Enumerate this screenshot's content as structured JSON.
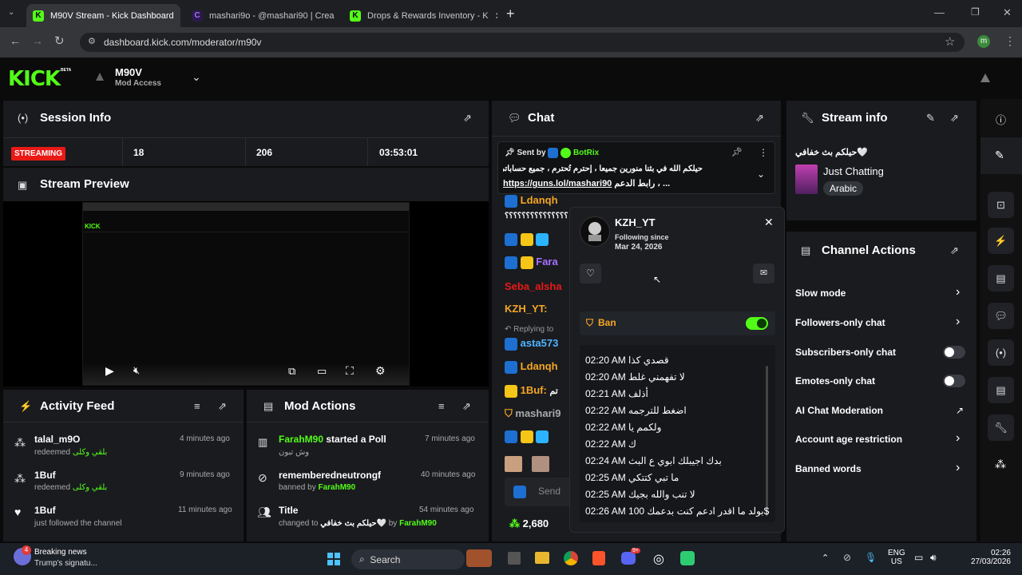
{
  "browser": {
    "tabs": [
      {
        "title": "M90V Stream - Kick Dashboard",
        "favicon": "K",
        "active": true
      },
      {
        "title": "mashari9o - @mashari90 | Crea",
        "favicon": "C",
        "active": false
      },
      {
        "title": "Drops & Rewards Inventory - K",
        "favicon": "K",
        "active": false
      }
    ],
    "url": "dashboard.kick.com/moderator/m90v",
    "profile_initial": "m"
  },
  "header": {
    "logo": "KICK",
    "beta": "BETA",
    "channel_name": "M90V",
    "channel_role": "Mod Access"
  },
  "session": {
    "title": "Session Info",
    "status": "STREAMING",
    "stat1": "18",
    "stat2": "206",
    "duration": "03:53:01"
  },
  "preview": {
    "title": "Stream Preview"
  },
  "activity": {
    "title": "Activity Feed",
    "items": [
      {
        "user": "talal_m9O",
        "action": "redeemed",
        "reward": "بلقي وكلى",
        "time": "4 minutes ago"
      },
      {
        "user": "1Buf",
        "action": "redeemed",
        "reward": "بلقي وكلى",
        "time": "9 minutes ago"
      },
      {
        "user": "1Buf",
        "action": "just followed the channel",
        "time": "11 minutes ago"
      }
    ]
  },
  "mod_actions": {
    "title": "Mod Actions",
    "items": [
      {
        "user": "FarahM90",
        "action": " started a Poll",
        "sub": "وش تبون",
        "time": "7 minutes ago"
      },
      {
        "user": "rememberedneutrongf",
        "action": "",
        "sub_prefix": "banned by ",
        "sub_user": "FarahM90",
        "time": "40 minutes ago"
      },
      {
        "user": "Title",
        "action": "",
        "sub_prefix": "changed to ",
        "sub_value": "حيلكم بث خفافي🤍",
        "sub_by": " by ",
        "sub_user": "FarahM90",
        "time": "54 minutes ago"
      }
    ]
  },
  "chat": {
    "title": "Chat",
    "pinned": {
      "label": "Sent by",
      "user": "BotRix",
      "text": "حيلكم الله في بثنا منورين جميعا ، إحترم تُحترم ، جميع حساباتي",
      "link": "https://guns.lol/mashari90",
      "link_suffix": "رابط الدعم ، ..."
    },
    "lines": [
      {
        "user": "Ldanqh",
        "color": "#f5a623",
        "text": "؟؟؟؟؟؟؟؟؟؟؟؟؟؟؟"
      },
      {
        "user": "",
        "color": "#53fc18",
        "text": ""
      },
      {
        "user": "Fara",
        "color": "#a970ff",
        "text": ""
      },
      {
        "user": "Seba_alsha",
        "color": "#e91916",
        "text": ""
      },
      {
        "user": "KZH_YT:",
        "color": "#f5a623",
        "text": ""
      },
      {
        "user": "asta573",
        "color": "#4fb3ff",
        "text": ""
      },
      {
        "user": "Ldanqh",
        "color": "#f5a623",
        "text": ""
      },
      {
        "user": "1Buf:",
        "color": "#f5a623",
        "text": "تم"
      },
      {
        "user": "mashari9",
        "color": "#aaaaaa",
        "text": ""
      }
    ],
    "replying": "Replying to",
    "send_placeholder": "Send",
    "points": "2,680"
  },
  "user_card": {
    "username": "KZH_YT",
    "following_label": "Following since",
    "following_date": "Mar 24, 2026",
    "ban_label": "Ban",
    "messages": [
      {
        "time": "02:20 AM",
        "text": "قصدي كذا"
      },
      {
        "time": "02:20 AM",
        "text": "لا تفهمني غلط"
      },
      {
        "time": "02:21 AM",
        "text": "أذلف"
      },
      {
        "time": "02:22 AM",
        "text": "اضغط للترجمه"
      },
      {
        "time": "02:22 AM",
        "text": "ولكمم يا"
      },
      {
        "time": "02:22 AM",
        "text": "ك"
      },
      {
        "time": "02:24 AM",
        "text": "بدك اجيبلك ابوي ع البث"
      },
      {
        "time": "02:25 AM",
        "text": "ما تبي كتتكي"
      },
      {
        "time": "02:25 AM",
        "text": "لا تنب والله بجيك"
      },
      {
        "time": "02:26 AM",
        "text": "بولد ما اقدر ادعم كنت بدعمك 100$"
      }
    ]
  },
  "stream_info": {
    "title": "Stream info",
    "stream_title": "حيلكم بث خفافي🤍",
    "category": "Just Chatting",
    "language": "Arabic"
  },
  "channel_actions": {
    "title": "Channel Actions",
    "items": [
      {
        "label": "Slow mode",
        "control": "chevron"
      },
      {
        "label": "Followers-only chat",
        "control": "chevron"
      },
      {
        "label": "Subscribers-only chat",
        "control": "toggle"
      },
      {
        "label": "Emotes-only chat",
        "control": "toggle"
      },
      {
        "label": "AI Chat Moderation",
        "control": "external"
      },
      {
        "label": "Account age restriction",
        "control": "chevron"
      },
      {
        "label": "Banned words",
        "control": "chevron"
      }
    ]
  },
  "taskbar": {
    "news_title": "Breaking news",
    "news_sub": "Trump's signatu...",
    "news_badge": "4",
    "search": "Search",
    "lang1": "ENG",
    "lang2": "US",
    "time": "02:26",
    "date": "27/03/2026",
    "discord_badge": "9+"
  }
}
